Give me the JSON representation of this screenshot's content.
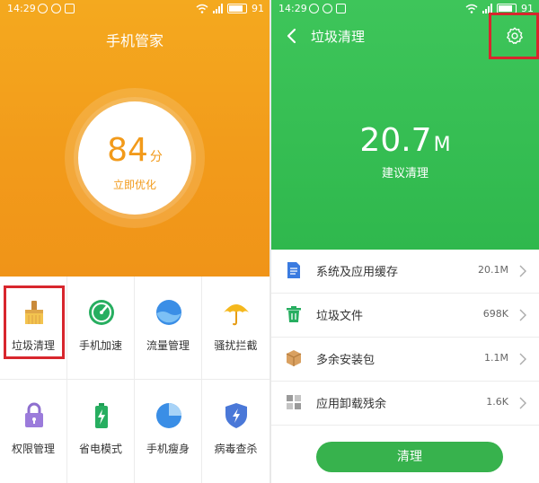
{
  "left_screen": {
    "status": {
      "time": "14:29",
      "battery": "91"
    },
    "title": "手机管家",
    "score": {
      "value": "84",
      "unit": "分",
      "action": "立即优化"
    },
    "grid": [
      {
        "label": "垃圾清理",
        "icon": "broom-icon"
      },
      {
        "label": "手机加速",
        "icon": "speedometer-icon"
      },
      {
        "label": "流量管理",
        "icon": "data-traffic-icon"
      },
      {
        "label": "骚扰拦截",
        "icon": "umbrella-icon"
      },
      {
        "label": "权限管理",
        "icon": "lock-icon"
      },
      {
        "label": "省电模式",
        "icon": "battery-icon"
      },
      {
        "label": "手机瘦身",
        "icon": "pie-chart-icon"
      },
      {
        "label": "病毒查杀",
        "icon": "shield-bolt-icon"
      }
    ]
  },
  "right_screen": {
    "status": {
      "time": "14:29",
      "battery": "91"
    },
    "title": "垃圾清理",
    "junk": {
      "value": "20.7",
      "unit": "M",
      "advice": "建议清理"
    },
    "items": [
      {
        "name": "系统及应用缓存",
        "size": "20.1M",
        "icon": "document-icon"
      },
      {
        "name": "垃圾文件",
        "size": "698K",
        "icon": "trash-icon"
      },
      {
        "name": "多余安装包",
        "size": "1.1M",
        "icon": "package-box-icon"
      },
      {
        "name": "应用卸载残余",
        "size": "1.6K",
        "icon": "grid-residue-icon"
      }
    ],
    "clean_button": "清理"
  },
  "colors": {
    "orange": "#f29a1a",
    "green": "#2fb84d",
    "highlight_red": "#d8262d"
  }
}
